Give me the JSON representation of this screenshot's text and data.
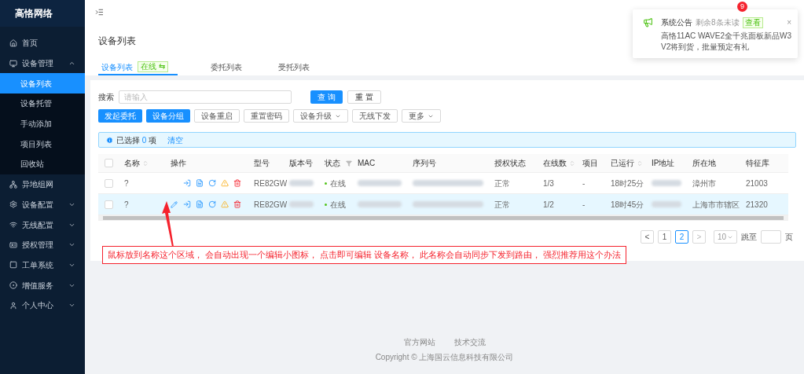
{
  "sidebar": {
    "brand": "高恪网络",
    "items": [
      {
        "label": "首页",
        "kind": "link"
      },
      {
        "label": "设备管理",
        "kind": "group",
        "expanded": true,
        "children": [
          {
            "label": "设备列表",
            "selected": true
          },
          {
            "label": "设备托管",
            "selected": false
          },
          {
            "label": "手动添加",
            "selected": false
          },
          {
            "label": "项目列表",
            "selected": false
          },
          {
            "label": "回收站",
            "selected": false
          }
        ]
      },
      {
        "label": "异地组网",
        "kind": "link"
      },
      {
        "label": "设备配置",
        "kind": "group",
        "expanded": false
      },
      {
        "label": "无线配置",
        "kind": "group",
        "expanded": false
      },
      {
        "label": "授权管理",
        "kind": "group",
        "expanded": false
      },
      {
        "label": "工单系统",
        "kind": "group",
        "expanded": false
      },
      {
        "label": "增值服务",
        "kind": "group",
        "expanded": false
      },
      {
        "label": "个人中心",
        "kind": "group",
        "expanded": false
      }
    ]
  },
  "header": {
    "badge": "9"
  },
  "notification": {
    "title": "系统公告",
    "subtitle": "剩余8条未读",
    "action": "查看",
    "body": "高恪11AC WAVE2全千兆面板新品W3 V2将到货，批量预定有礼",
    "close": "×"
  },
  "page_title": "设备列表",
  "tabs": [
    {
      "label": "设备列表",
      "badge": "在线 ⇆",
      "selected": true
    },
    {
      "label": "委托列表",
      "selected": false
    },
    {
      "label": "受托列表",
      "selected": false
    }
  ],
  "search": {
    "label": "搜索",
    "placeholder": "请输入",
    "buttons": [
      {
        "label": "查 询",
        "primary": true
      },
      {
        "label": "重 置",
        "primary": false
      }
    ]
  },
  "toolbar": [
    {
      "label": "发起委托",
      "primary": true,
      "dropdown": false
    },
    {
      "label": "设备分组",
      "primary": true,
      "dropdown": false
    },
    {
      "label": "设备重启",
      "primary": false,
      "dropdown": false
    },
    {
      "label": "重置密码",
      "primary": false,
      "dropdown": false
    },
    {
      "label": "设备升级",
      "primary": false,
      "dropdown": true
    },
    {
      "label": "无线下发",
      "primary": false,
      "dropdown": false
    },
    {
      "label": "更多",
      "primary": false,
      "dropdown": true
    }
  ],
  "selection": {
    "prefix": "已选择",
    "count": "0",
    "suffix": "项",
    "clear": "清空"
  },
  "table": {
    "header_checked": false,
    "columns": [
      {
        "label": "名称",
        "kind": "text",
        "sortable": true,
        "filterable": false
      },
      {
        "label": "操作",
        "kind": "actions",
        "sortable": false,
        "filterable": false
      },
      {
        "label": "型号",
        "kind": "text",
        "sortable": false,
        "filterable": false
      },
      {
        "label": "版本号",
        "kind": "blurred",
        "sortable": false,
        "filterable": false
      },
      {
        "label": "状态",
        "kind": "status",
        "sortable": false,
        "filterable": true
      },
      {
        "label": "MAC",
        "kind": "blurred",
        "sortable": false,
        "filterable": false
      },
      {
        "label": "序列号",
        "kind": "blurred",
        "sortable": false,
        "filterable": false
      },
      {
        "label": "授权状态",
        "kind": "text",
        "sortable": false,
        "filterable": false
      },
      {
        "label": "在线数",
        "kind": "text",
        "sortable": true,
        "filterable": false
      },
      {
        "label": "项目",
        "kind": "text",
        "sortable": false,
        "filterable": false
      },
      {
        "label": "已运行",
        "kind": "text",
        "sortable": true,
        "filterable": false
      },
      {
        "label": "IP地址",
        "kind": "blurred",
        "sortable": false,
        "filterable": false
      },
      {
        "label": "所在地",
        "kind": "text",
        "sortable": false,
        "filterable": false
      },
      {
        "label": "特征库",
        "kind": "text",
        "sortable": false,
        "filterable": false
      }
    ],
    "rows": [
      {
        "checked": false,
        "hovered": false,
        "cells": [
          "?",
          null,
          "RE82GW",
          null,
          "在线",
          null,
          null,
          "正常",
          "1/3",
          "-",
          "18时25分",
          null,
          "漳州市",
          "21003"
        ]
      },
      {
        "checked": false,
        "hovered": true,
        "cells": [
          "?",
          null,
          "RE82GW",
          null,
          "在线",
          null,
          null,
          "正常",
          "1/2",
          "-",
          "18时45分",
          null,
          "上海市市辖区",
          "21320"
        ]
      }
    ]
  },
  "pagination": {
    "prev": "<",
    "next": ">",
    "pages": [
      {
        "label": "1",
        "selected": false
      },
      {
        "label": "2",
        "selected": true
      }
    ],
    "page_size": "10",
    "jump_label": "跳至",
    "jump_suffix": "页"
  },
  "annotation": "鼠标放到名称这个区域， 会自动出现一个编辑小图标， 点击即可编辑 设备名称， 此名称会自动同步下发到路由， 强烈推荐用这个办法",
  "footer": {
    "links": [
      "官方网站",
      "技术交流"
    ],
    "copyright": "Copyright © 上海国云信息科技有限公司"
  }
}
